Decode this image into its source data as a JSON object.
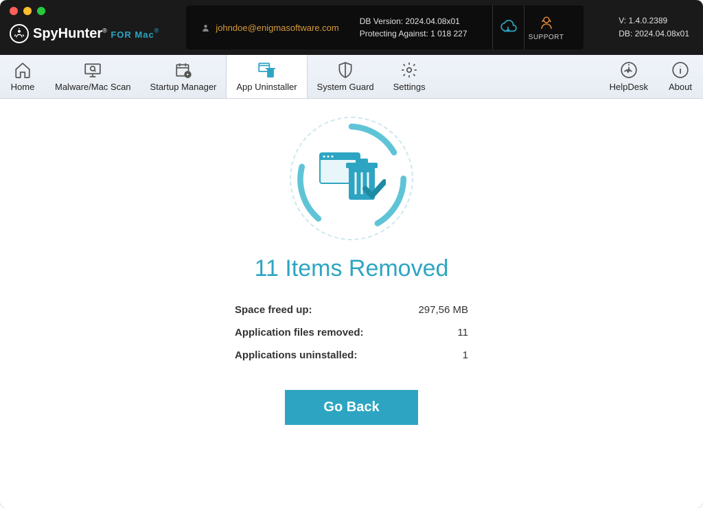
{
  "header": {
    "brand_main": "SpyHunter",
    "brand_sub": "FOR Mac",
    "user_email": "johndoe@enigmasoftware.com",
    "db_version_line": "DB Version: 2024.04.08x01",
    "protecting_line": "Protecting Against: 1 018 227",
    "support_label": "SUPPORT",
    "version_line": "V: 1.4.0.2389",
    "db_line": "DB:  2024.04.08x01"
  },
  "tabs": {
    "home": "Home",
    "scan": "Malware/Mac Scan",
    "startup": "Startup Manager",
    "uninstaller": "App Uninstaller",
    "guard": "System Guard",
    "settings": "Settings",
    "helpdesk": "HelpDesk",
    "about": "About"
  },
  "result": {
    "title": "11 Items Removed",
    "rows": [
      {
        "label": "Space freed up:",
        "value": "297,56 MB"
      },
      {
        "label": "Application files removed:",
        "value": "11"
      },
      {
        "label": "Applications uninstalled:",
        "value": "1"
      }
    ],
    "go_back": "Go Back"
  }
}
